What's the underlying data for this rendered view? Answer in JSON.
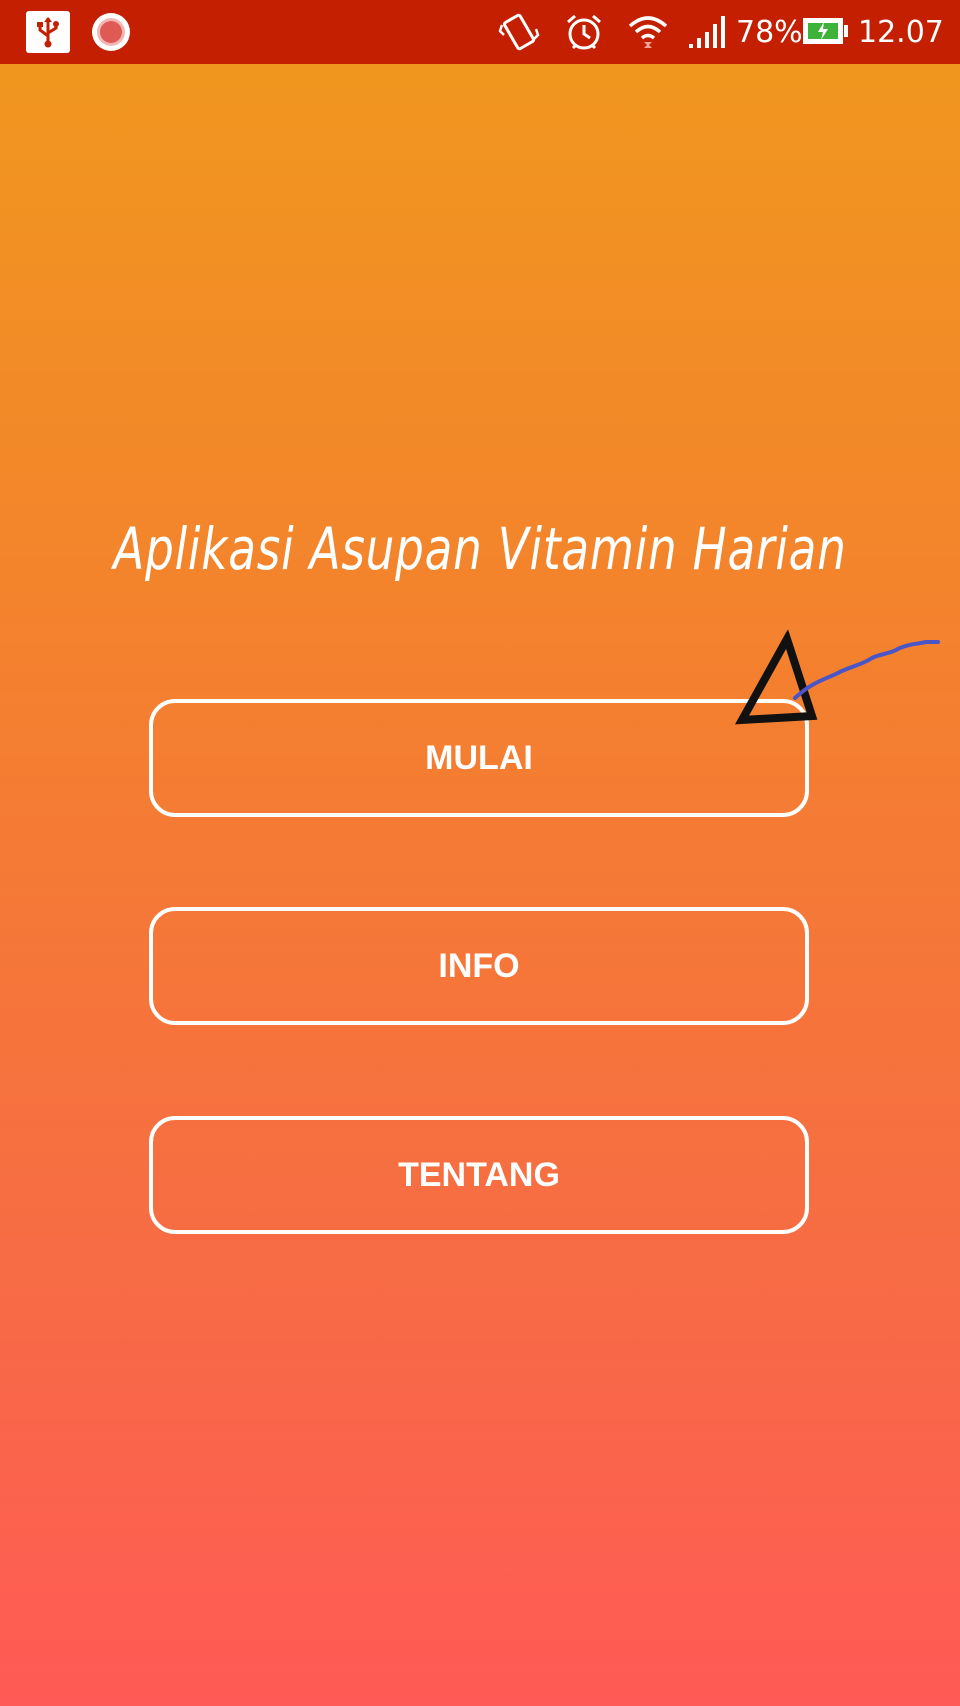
{
  "status_bar": {
    "battery_percent": "78%",
    "time": "12.07",
    "icons": [
      "usb-icon",
      "screen-record-icon",
      "vibrate-icon",
      "alarm-icon",
      "wifi-icon",
      "signal-icon",
      "battery-charging-icon"
    ]
  },
  "app": {
    "title": "Aplikasi Asupan Vitamin Harian"
  },
  "menu": {
    "buttons": [
      {
        "label": "MULAI"
      },
      {
        "label": "INFO"
      },
      {
        "label": "TENTANG"
      }
    ]
  },
  "colors": {
    "status_bar": "#c41f00",
    "gradient_top": "#f0991d",
    "gradient_bottom": "#ff5a55",
    "button_border": "#ffffff",
    "annotation_line": "#4a55c8"
  }
}
